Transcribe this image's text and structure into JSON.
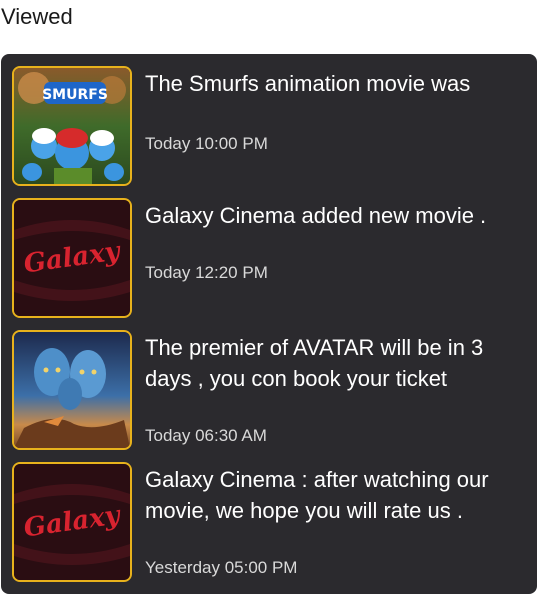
{
  "section": {
    "title": "Viewed"
  },
  "notifications": [
    {
      "message": "The Smurfs animation movie was",
      "time": "Today 10:00 PM",
      "thumbnail": "smurfs-poster",
      "thumbnail_logo_text": "SMURFS"
    },
    {
      "message": "Galaxy Cinema added new movie .",
      "time": "Today 12:20 PM",
      "thumbnail": "galaxy-cinema-logo",
      "thumbnail_logo_text": "Galaxy"
    },
    {
      "message": "The premier of AVATAR will be in 3 days , you con book your ticket",
      "time": "Today 06:30 AM",
      "thumbnail": "avatar-poster"
    },
    {
      "message": "Galaxy Cinema : after watching our movie, we hope you will rate us .",
      "time": "Yesterday 05:00 PM",
      "thumbnail": "galaxy-cinema-logo",
      "thumbnail_logo_text": "Galaxy"
    }
  ],
  "colors": {
    "panel_background": "#2b2a2e",
    "thumbnail_border": "#e8b21c",
    "text_primary": "#ffffff",
    "text_secondary": "#d9d9d9"
  }
}
